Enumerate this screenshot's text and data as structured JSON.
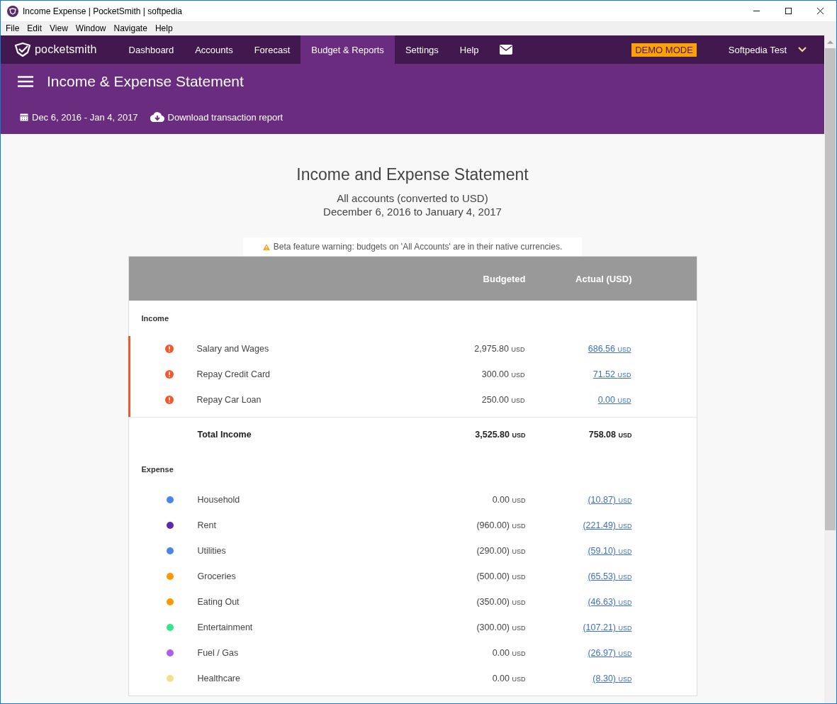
{
  "window": {
    "title": "Income Expense | PocketSmith | softpedia"
  },
  "menu_bar": [
    "File",
    "Edit",
    "View",
    "Window",
    "Navigate",
    "Help"
  ],
  "nav": {
    "brand": "pocketsmith",
    "items": [
      {
        "label": "Dashboard",
        "selected": false
      },
      {
        "label": "Accounts",
        "selected": false
      },
      {
        "label": "Forecast",
        "selected": false
      },
      {
        "label": "Budget & Reports",
        "selected": true
      },
      {
        "label": "Settings",
        "selected": false
      },
      {
        "label": "Help",
        "selected": false
      }
    ],
    "badge": "DEMO MODE",
    "user": "Softpedia Test"
  },
  "header": {
    "title": "Income & Expense Statement",
    "date_range": "Dec 6, 2016 - Jan 4, 2017",
    "download": "Download transaction report"
  },
  "report": {
    "title": "Income and Expense Statement",
    "subtitle": "All accounts (converted to USD)",
    "period": "December 6, 2016 to January 4, 2017",
    "warning": "Beta feature warning: budgets on 'All Accounts' are in their native currencies.",
    "columns": [
      "Budgeted",
      "Actual (USD)"
    ],
    "sections": [
      {
        "label": "Income",
        "rows": [
          {
            "kind": "alert",
            "name": "Salary and Wages",
            "budgeted": {
              "amount": "2,975.80",
              "unit": "USD"
            },
            "actual": {
              "amount": "686.56",
              "unit": "USD"
            }
          },
          {
            "kind": "alert",
            "name": "Repay Credit Card",
            "budgeted": {
              "amount": "300.00",
              "unit": "USD"
            },
            "actual": {
              "amount": "71.52",
              "unit": "USD"
            }
          },
          {
            "kind": "alert",
            "name": "Repay Car Loan",
            "budgeted": {
              "amount": "250.00",
              "unit": "USD"
            },
            "actual": {
              "amount": "0.00",
              "unit": "USD"
            }
          }
        ],
        "total": {
          "name": "Total Income",
          "budgeted": {
            "amount": "3,525.80",
            "unit": "USD"
          },
          "actual": {
            "amount": "758.08",
            "unit": "USD"
          }
        }
      },
      {
        "label": "Expense",
        "rows": [
          {
            "kind": "dot",
            "color": "#4a86e8",
            "name": "Household",
            "budgeted": {
              "amount": "0.00",
              "unit": "USD"
            },
            "actual": {
              "amount": "(10.87)",
              "unit": "USD"
            }
          },
          {
            "kind": "dot",
            "color": "#5b2aa8",
            "name": "Rent",
            "budgeted": {
              "amount": "(960.00)",
              "unit": "USD"
            },
            "actual": {
              "amount": "(221.49)",
              "unit": "USD"
            }
          },
          {
            "kind": "dot",
            "color": "#4a86e8",
            "name": "Utilities",
            "budgeted": {
              "amount": "(290.00)",
              "unit": "USD"
            },
            "actual": {
              "amount": "(59.10)",
              "unit": "USD"
            }
          },
          {
            "kind": "dot",
            "color": "#ff9800",
            "name": "Groceries",
            "budgeted": {
              "amount": "(500.00)",
              "unit": "USD"
            },
            "actual": {
              "amount": "(65.53)",
              "unit": "USD"
            }
          },
          {
            "kind": "dot",
            "color": "#ff9800",
            "name": "Eating Out",
            "budgeted": {
              "amount": "(350.00)",
              "unit": "USD"
            },
            "actual": {
              "amount": "(46.63)",
              "unit": "USD"
            }
          },
          {
            "kind": "dot",
            "color": "#2ee88a",
            "name": "Entertainment",
            "budgeted": {
              "amount": "(300.00)",
              "unit": "USD"
            },
            "actual": {
              "amount": "(107.21)",
              "unit": "USD"
            }
          },
          {
            "kind": "dot",
            "color": "#b05ef0",
            "name": "Fuel / Gas",
            "budgeted": {
              "amount": "0.00",
              "unit": "USD"
            },
            "actual": {
              "amount": "(26.97)",
              "unit": "USD"
            }
          },
          {
            "kind": "dot",
            "color": "#f2e08a",
            "name": "Healthcare",
            "budgeted": {
              "amount": "0.00",
              "unit": "USD"
            },
            "actual": {
              "amount": "(8.30)",
              "unit": "USD"
            }
          }
        ]
      }
    ]
  }
}
